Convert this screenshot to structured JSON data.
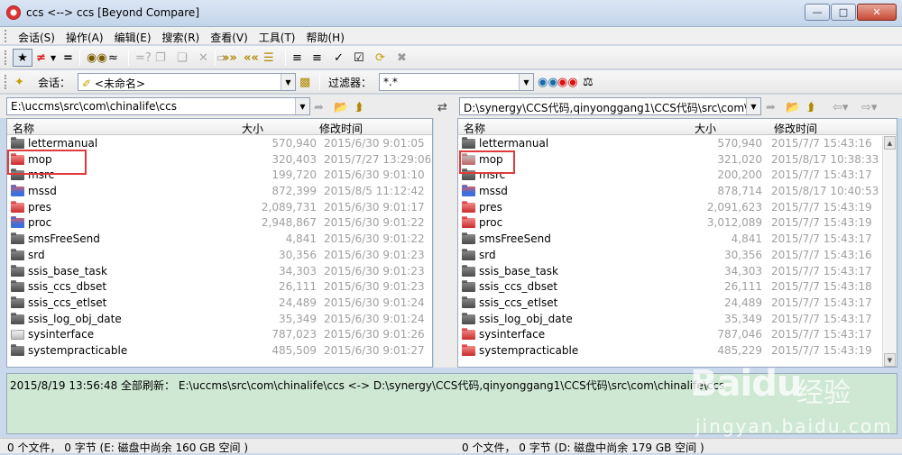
{
  "window": {
    "title": "ccs <--> ccs  [Beyond Compare]",
    "controls": [
      "minimize",
      "maximize",
      "close"
    ]
  },
  "menu": [
    "会话(S)",
    "操作(A)",
    "编辑(E)",
    "搜索(R)",
    "查看(V)",
    "工具(T)",
    "帮助(H)"
  ],
  "toolbar2": {
    "session_label": "会话：",
    "session_value": "<未命名>",
    "filter_label": "过滤器：",
    "filter_value": "*.*"
  },
  "left": {
    "path": "E:\\uccms\\src\\com\\chinalife\\ccs",
    "col_name": "名称",
    "col_size": "大小",
    "col_time": "修改时间",
    "rows": [
      {
        "name": "lettermanual",
        "size": "570,940",
        "time": "2015/6/30 9:01:05",
        "folder": "dark"
      },
      {
        "name": "mop",
        "size": "320,403",
        "time": "2015/7/27 13:29:06",
        "folder": "red"
      },
      {
        "name": "msrc",
        "size": "199,720",
        "time": "2015/6/30 9:01:10",
        "folder": "dark"
      },
      {
        "name": "mssd",
        "size": "872,399",
        "time": "2015/8/5 11:12:42",
        "folder": "blue"
      },
      {
        "name": "pres",
        "size": "2,089,731",
        "time": "2015/6/30 9:01:17",
        "folder": "red"
      },
      {
        "name": "proc",
        "size": "2,948,867",
        "time": "2015/6/30 9:01:22",
        "folder": "blue"
      },
      {
        "name": "smsFreeSend",
        "size": "4,841",
        "time": "2015/6/30 9:01:22",
        "folder": "dark"
      },
      {
        "name": "srd",
        "size": "30,356",
        "time": "2015/6/30 9:01:23",
        "folder": "dark"
      },
      {
        "name": "ssis_base_task",
        "size": "34,303",
        "time": "2015/6/30 9:01:23",
        "folder": "dark"
      },
      {
        "name": "ssis_ccs_dbset",
        "size": "26,111",
        "time": "2015/6/30 9:01:23",
        "folder": "dark"
      },
      {
        "name": "ssis_ccs_etlset",
        "size": "24,489",
        "time": "2015/6/30 9:01:24",
        "folder": "dark"
      },
      {
        "name": "ssis_log_obj_date",
        "size": "35,349",
        "time": "2015/6/30 9:01:24",
        "folder": "dark"
      },
      {
        "name": "sysinterface",
        "size": "787,023",
        "time": "2015/6/30 9:01:26",
        "folder": "white"
      },
      {
        "name": "systempracticable",
        "size": "485,509",
        "time": "2015/6/30 9:01:27",
        "folder": "dark"
      }
    ]
  },
  "right": {
    "path": "D:\\synergy\\CCS代码,qinyonggang1\\CCS代码\\src\\com\\ch",
    "col_name": "名称",
    "col_size": "大小",
    "col_time": "修改时间",
    "rows": [
      {
        "name": "lettermanual",
        "size": "570,940",
        "time": "2015/7/7 15:43:16",
        "folder": "dark"
      },
      {
        "name": "mop",
        "size": "321,020",
        "time": "2015/8/17 10:38:33",
        "folder": "grayred"
      },
      {
        "name": "msrc",
        "size": "200,200",
        "time": "2015/7/7 15:43:17",
        "folder": "dark"
      },
      {
        "name": "mssd",
        "size": "878,714",
        "time": "2015/8/17 10:40:53",
        "folder": "blue"
      },
      {
        "name": "pres",
        "size": "2,091,623",
        "time": "2015/7/7 15:43:19",
        "folder": "red"
      },
      {
        "name": "proc",
        "size": "3,012,089",
        "time": "2015/7/7 15:43:19",
        "folder": "red"
      },
      {
        "name": "smsFreeSend",
        "size": "4,841",
        "time": "2015/7/7 15:43:17",
        "folder": "dark"
      },
      {
        "name": "srd",
        "size": "30,356",
        "time": "2015/7/7 15:43:16",
        "folder": "dark"
      },
      {
        "name": "ssis_base_task",
        "size": "34,303",
        "time": "2015/7/7 15:43:17",
        "folder": "dark"
      },
      {
        "name": "ssis_ccs_dbset",
        "size": "26,111",
        "time": "2015/7/7 15:43:18",
        "folder": "dark"
      },
      {
        "name": "ssis_ccs_etlset",
        "size": "24,489",
        "time": "2015/7/7 15:43:17",
        "folder": "dark"
      },
      {
        "name": "ssis_log_obj_date",
        "size": "35,349",
        "time": "2015/7/7 15:43:17",
        "folder": "dark"
      },
      {
        "name": "sysinterface",
        "size": "787,046",
        "time": "2015/7/7 15:43:17",
        "folder": "red"
      },
      {
        "name": "systempracticable",
        "size": "485,229",
        "time": "2015/7/7 15:43:19",
        "folder": "red"
      }
    ]
  },
  "log": {
    "text": "2015/8/19 13:56:48  全部刷新： E:\\uccms\\src\\com\\chinalife\\ccs <-> D:\\synergy\\CCS代码,qinyonggang1\\CCS代码\\src\\com\\chinalife\\ccs"
  },
  "status": {
    "left": "0 个文件， 0 字节  (E: 磁盘中尚余 160 GB 空间 )",
    "right": "0 个文件， 0 字节  (D: 磁盘中尚余 179 GB 空间 )"
  },
  "watermark": {
    "brand": "Baidu",
    "cn": "经验",
    "url": "jingyan.baidu.com"
  }
}
